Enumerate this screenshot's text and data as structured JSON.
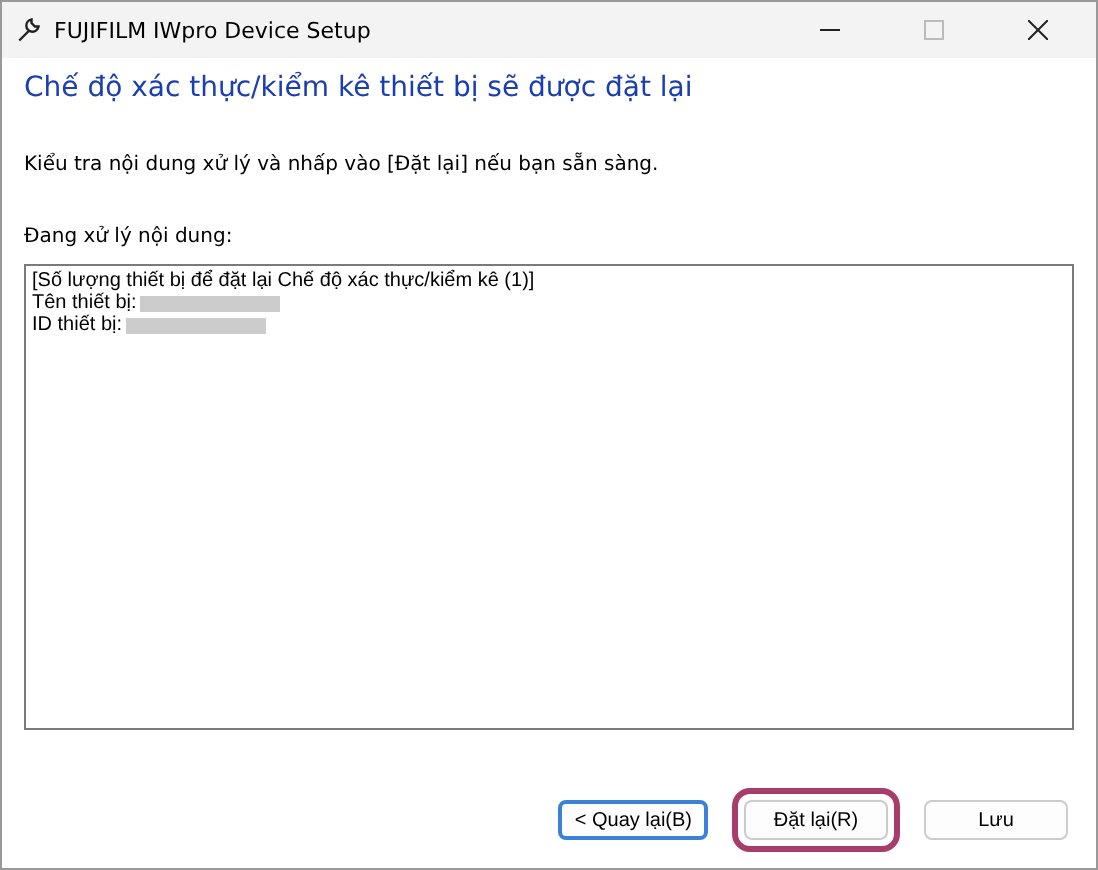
{
  "window": {
    "title": "FUJIFILM IWpro Device Setup"
  },
  "heading": "Chế độ xác thực/kiểm kê thiết bị sẽ được đặt lại",
  "instruction": "Kiểu tra nội dung xử lý và nhấp vào [Đặt lại] nếu bạn sẵn sàng.",
  "content_label": "Đang xử lý nội dung:",
  "content_lines": [
    {
      "text": "[Số lượng thiết bị để đặt lại Chế độ xác thực/kiểm kê (1)]",
      "redacted": false
    },
    {
      "text": "Tên thiết bị:",
      "redacted": true
    },
    {
      "text": "ID thiết bị:",
      "redacted": true
    }
  ],
  "buttons": [
    {
      "label": "< Quay lại(B)",
      "focused": true,
      "highlighted": false
    },
    {
      "label": "Đặt lại(R)",
      "focused": false,
      "highlighted": true
    },
    {
      "label": "Lưu",
      "focused": false,
      "highlighted": false
    }
  ]
}
